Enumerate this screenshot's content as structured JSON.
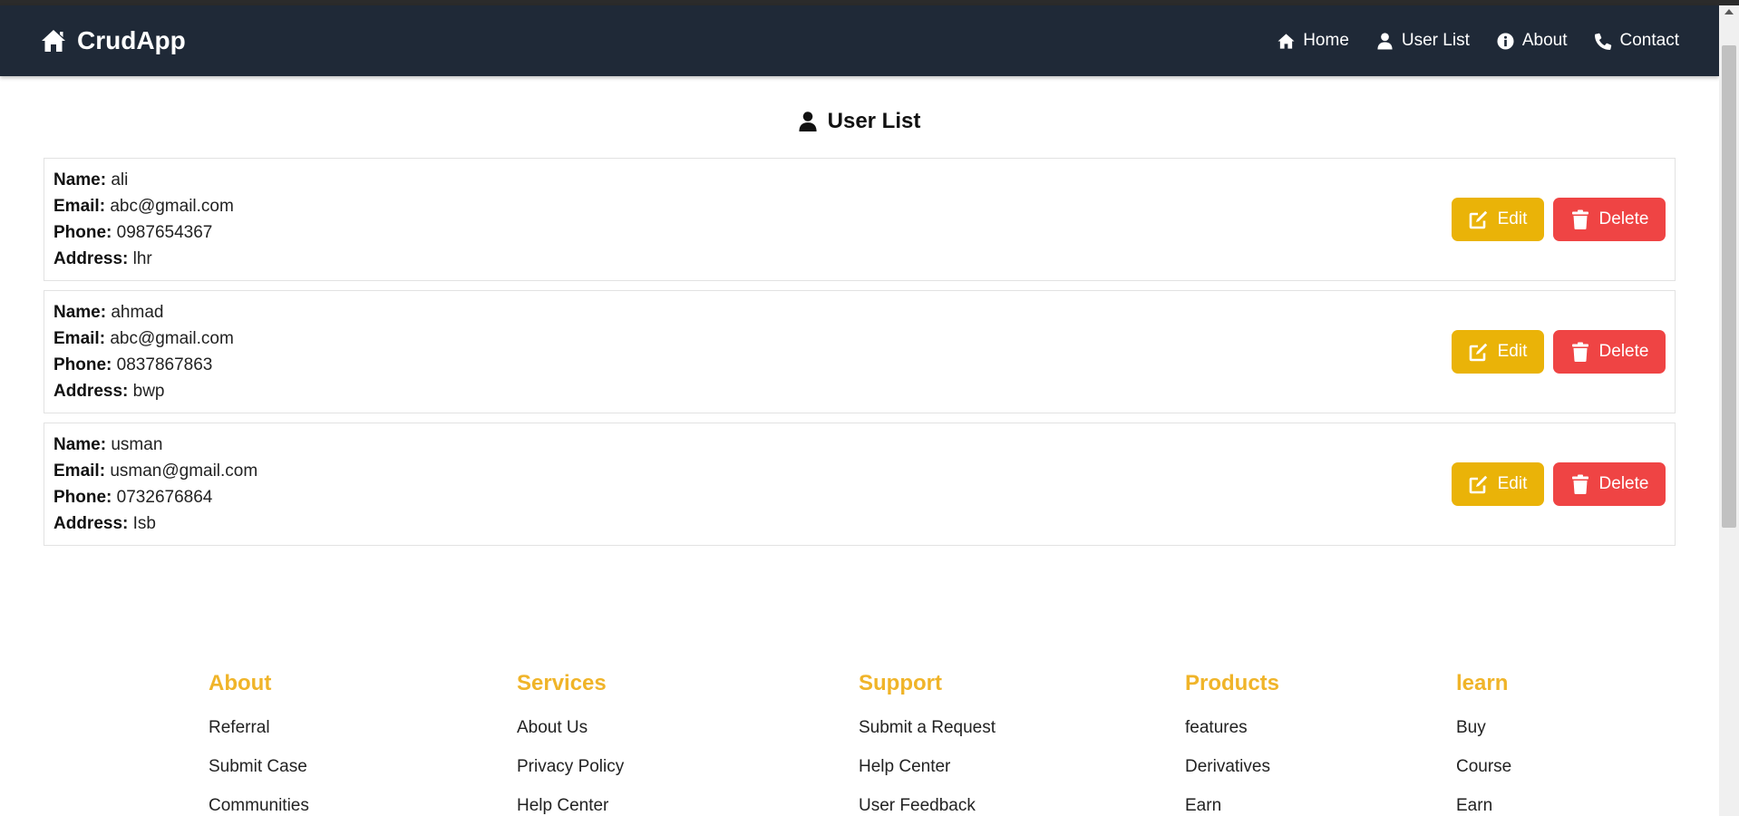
{
  "navbar": {
    "brand": "CrudApp",
    "links": [
      {
        "label": "Home",
        "icon": "home-icon"
      },
      {
        "label": "User List",
        "icon": "user-icon"
      },
      {
        "label": "About",
        "icon": "info-icon"
      },
      {
        "label": "Contact",
        "icon": "phone-icon"
      }
    ]
  },
  "page": {
    "title": "User List"
  },
  "labels": {
    "name": "Name:",
    "email": "Email:",
    "phone": "Phone:",
    "address": "Address:"
  },
  "buttons": {
    "edit": "Edit",
    "delete": "Delete"
  },
  "users": [
    {
      "name": "ali",
      "email": "abc@gmail.com",
      "phone": "0987654367",
      "address": "lhr"
    },
    {
      "name": "ahmad",
      "email": "abc@gmail.com",
      "phone": "0837867863",
      "address": "bwp"
    },
    {
      "name": "usman",
      "email": "usman@gmail.com",
      "phone": "0732676864",
      "address": "Isb"
    }
  ],
  "footer": {
    "columns": [
      {
        "title": "About",
        "links": [
          "Referral",
          "Submit Case",
          "Communities"
        ]
      },
      {
        "title": "Services",
        "links": [
          "About Us",
          "Privacy Policy",
          "Help Center"
        ]
      },
      {
        "title": "Support",
        "links": [
          "Submit a Request",
          "Help Center",
          "User Feedback"
        ]
      },
      {
        "title": "Products",
        "links": [
          "features",
          "Derivatives",
          "Earn"
        ]
      },
      {
        "title": "learn",
        "links": [
          "Buy",
          "Course",
          "Earn"
        ]
      }
    ]
  },
  "colors": {
    "navbar_bg": "#1f2937",
    "edit_button": "#eab308",
    "delete_button": "#ef4444",
    "footer_heading": "#f0b429"
  }
}
